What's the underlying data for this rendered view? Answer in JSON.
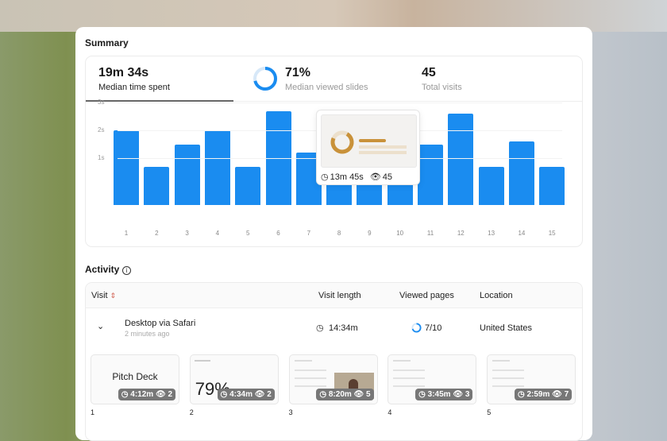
{
  "summary": {
    "title": "Summary",
    "stats": [
      {
        "value": "19m 34s",
        "label": "Median time spent"
      },
      {
        "value": "71%",
        "label": "Median viewed slides",
        "ring": 0.71
      },
      {
        "value": "45",
        "label": "Total visits"
      }
    ]
  },
  "chart_data": {
    "type": "bar",
    "categories": [
      "1",
      "2",
      "3",
      "4",
      "5",
      "6",
      "7",
      "8",
      "9",
      "10",
      "11",
      "12",
      "13",
      "14",
      "15"
    ],
    "values": [
      2.0,
      0.7,
      1.5,
      2.0,
      0.7,
      2.7,
      1.2,
      0.7,
      0.7,
      0.7,
      1.5,
      2.6,
      0.7,
      1.6,
      0.7
    ],
    "yticks": [
      "1s",
      "2s",
      "3s"
    ],
    "ylabel": "",
    "xlabel": "",
    "color": "#1a8cf0"
  },
  "tooltip": {
    "time": "13m 45s",
    "views": "45"
  },
  "activity": {
    "title": "Activity",
    "columns": [
      "Visit",
      "Visit length",
      "Viewed pages",
      "Location"
    ],
    "row": {
      "device": "Desktop via Safari",
      "when": "2 minutes ago",
      "length": "14:34m",
      "pages": "7/10",
      "pages_fraction": 0.7,
      "location": "United States"
    },
    "thumbs": [
      {
        "n": "1",
        "time": "4:12m",
        "views": "2",
        "title": "Pitch Deck"
      },
      {
        "n": "2",
        "time": "4:34m",
        "views": "2",
        "title": "79%"
      },
      {
        "n": "3",
        "time": "8:20m",
        "views": "5"
      },
      {
        "n": "4",
        "time": "3:45m",
        "views": "3"
      },
      {
        "n": "5",
        "time": "2:59m",
        "views": "7"
      }
    ]
  }
}
